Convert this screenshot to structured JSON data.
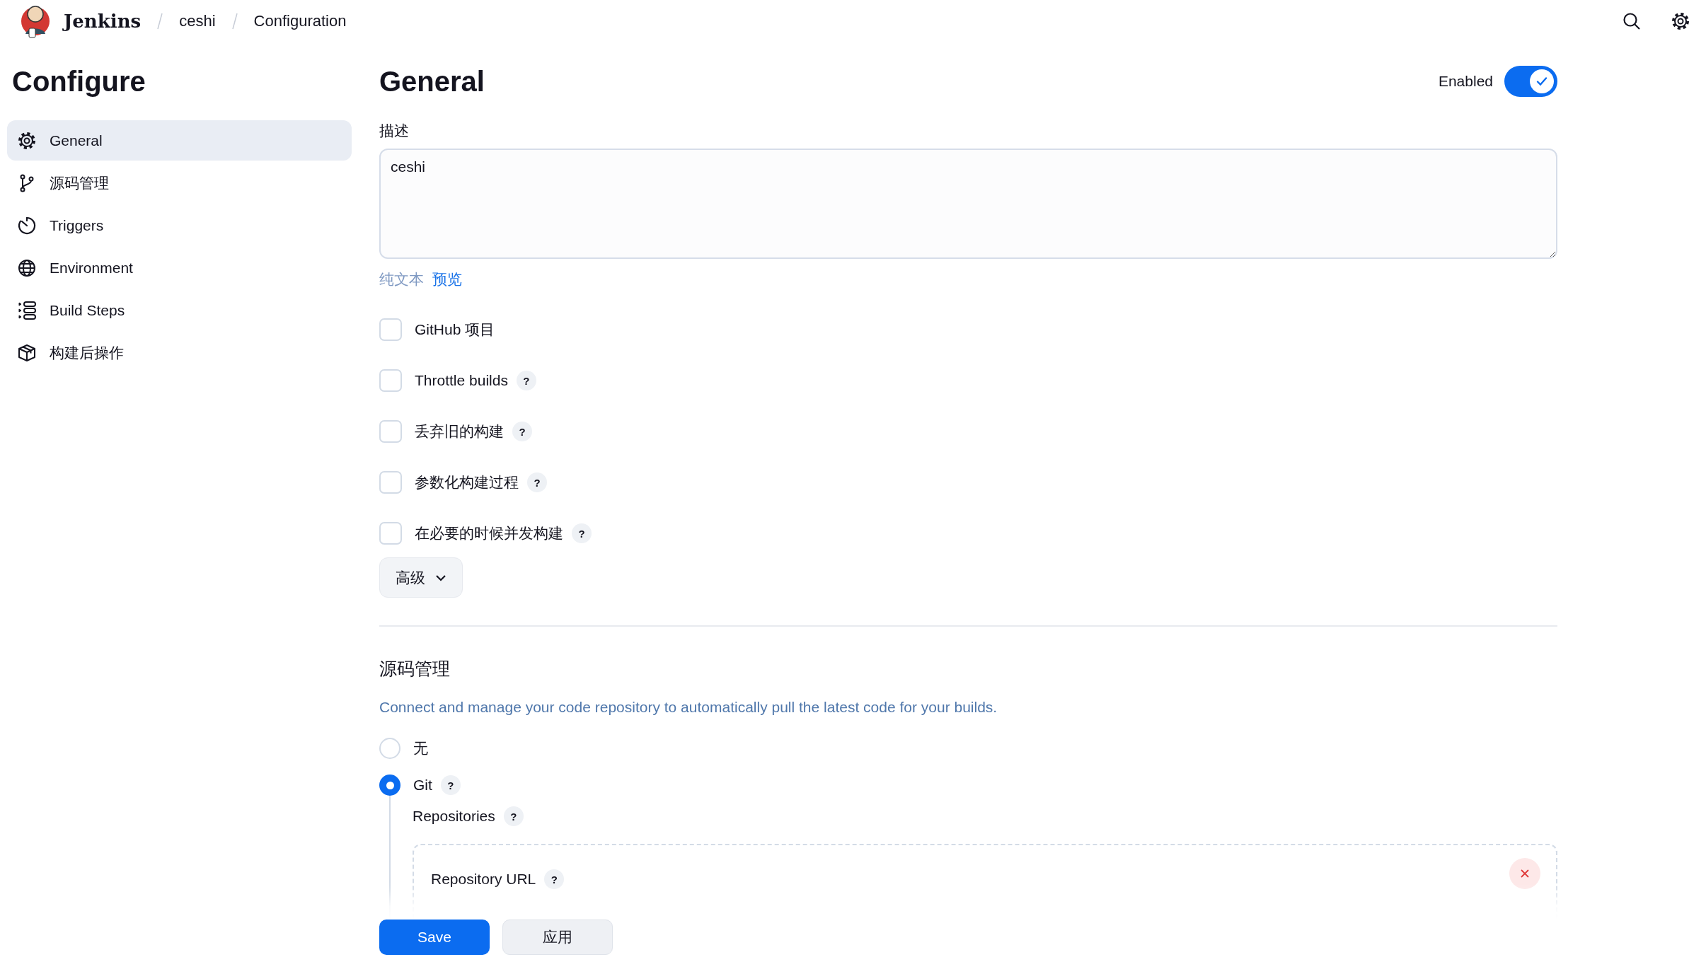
{
  "header": {
    "brand": "Jenkins",
    "breadcrumbs": [
      "ceshi",
      "Configuration"
    ]
  },
  "sidebar": {
    "title": "Configure",
    "items": [
      {
        "label": "General",
        "selected": true
      },
      {
        "label": "源码管理",
        "selected": false
      },
      {
        "label": "Triggers",
        "selected": false
      },
      {
        "label": "Environment",
        "selected": false
      },
      {
        "label": "Build Steps",
        "selected": false
      },
      {
        "label": "构建后操作",
        "selected": false
      }
    ]
  },
  "general": {
    "title": "General",
    "enabled": {
      "label": "Enabled",
      "on": true
    },
    "description": {
      "label": "描述",
      "value": "ceshi"
    },
    "plain_text": "纯文本",
    "preview": "预览",
    "options": [
      {
        "label": "GitHub 项目",
        "checked": false
      },
      {
        "label": "Throttle builds",
        "checked": false,
        "help": "?"
      },
      {
        "label": "丢弃旧的构建",
        "checked": false,
        "help": "?"
      },
      {
        "label": "参数化构建过程",
        "checked": false,
        "help": "?"
      },
      {
        "label": "在必要的时候并发构建",
        "checked": false,
        "help": "?"
      }
    ],
    "advanced": "高级"
  },
  "scm": {
    "title": "源码管理",
    "description": "Connect and manage your code repository to automatically pull the latest code for your builds.",
    "options": [
      {
        "label": "无",
        "selected": false
      },
      {
        "label": "Git",
        "selected": true,
        "help": "?"
      }
    ],
    "repositories": {
      "label": "Repositories",
      "help": "?",
      "url_label": "Repository URL",
      "url_help": "?"
    }
  },
  "footer": {
    "save": "Save",
    "apply": "应用"
  }
}
